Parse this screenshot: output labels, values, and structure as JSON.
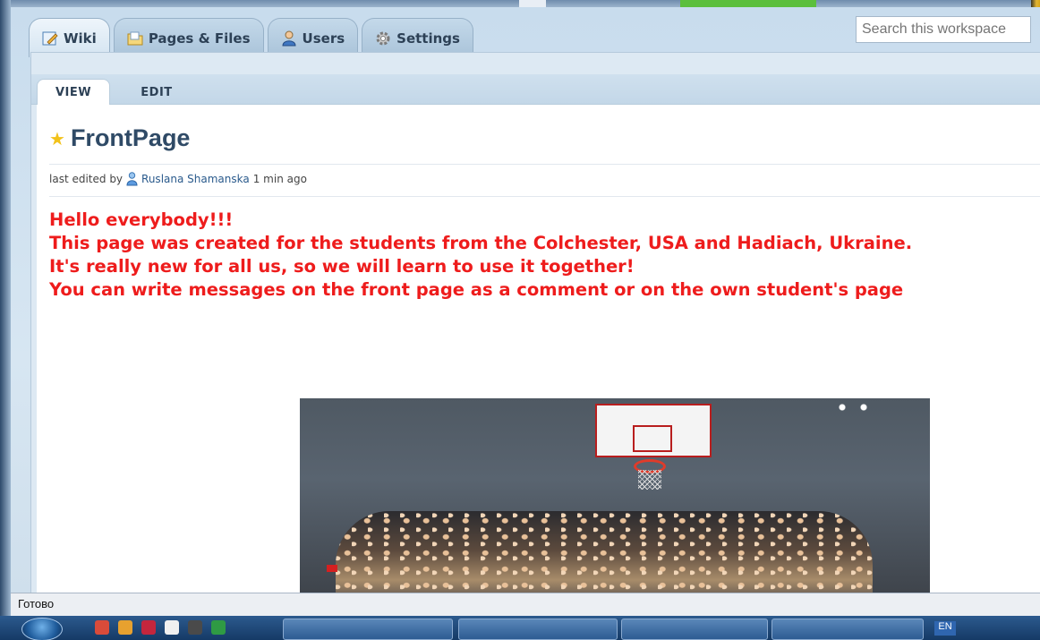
{
  "main_tabs": [
    {
      "label": "Wiki",
      "icon": "wiki-edit-icon",
      "active": true
    },
    {
      "label": "Pages & Files",
      "icon": "folder-icon",
      "active": false
    },
    {
      "label": "Users",
      "icon": "users-icon",
      "active": false
    },
    {
      "label": "Settings",
      "icon": "gear-icon",
      "active": false
    }
  ],
  "search": {
    "placeholder": "Search this workspace"
  },
  "sub_tabs": {
    "view": "VIEW",
    "edit": "EDIT"
  },
  "page": {
    "title": "FrontPage",
    "meta_prefix": "last edited by",
    "meta_user": "Ruslana Shamanska",
    "meta_time": "1 min ago",
    "message_lines": [
      "Hello everybody!!!",
      "This page was created for the students from the Colchester, USA and Hadiach, Ukraine.",
      "It's really new for all us, so we will learn to use it together!",
      "You can write messages  on the front page as a comment or on the own student's page"
    ]
  },
  "status_bar": {
    "text": "Готово"
  },
  "taskbar": {
    "language": "EN"
  },
  "colors": {
    "message_text": "#ee1c1c",
    "title_text": "#2f4a66",
    "star": "#f2c21a"
  }
}
